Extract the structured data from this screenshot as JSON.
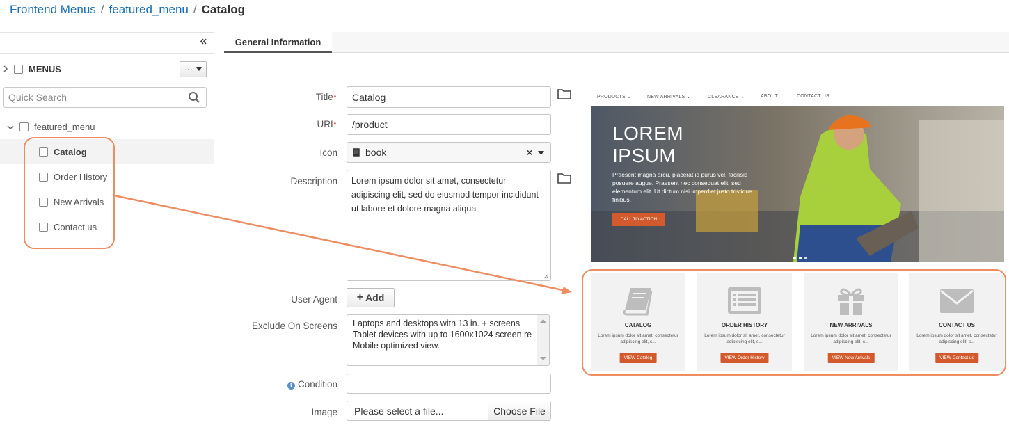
{
  "breadcrumb": {
    "items": [
      "Frontend Menus",
      "featured_menu"
    ],
    "current": "Catalog",
    "separator": "/"
  },
  "sidebar": {
    "collapse_icon": "double-chevron-left",
    "root_label": "MENUS",
    "actions_label": "···",
    "search_placeholder": "Quick Search",
    "tree": {
      "parent": "featured_menu",
      "children": [
        "Catalog",
        "Order History",
        "New Arrivals",
        "Contact us"
      ],
      "selected": "Catalog"
    }
  },
  "tabs": {
    "active": "General Information"
  },
  "form": {
    "title_label": "Title",
    "title_value": "Catalog",
    "uri_label": "URI",
    "uri_value": "/product",
    "icon_label": "Icon",
    "icon_value": "book",
    "description_label": "Description",
    "description_value": "Lorem ipsum dolor sit amet, consectetur adipiscing elit, sed do eiusmod tempor incididunt ut labore et dolore magna aliqua",
    "user_agent_label": "User Agent",
    "add_label": "Add",
    "exclude_label": "Exclude On Screens",
    "exclude_options": [
      "Laptops and desktops with 13 in. + screens",
      "Tablet devices with up to 1600x1024 screen re",
      "Mobile optimized view."
    ],
    "condition_label": "Condition",
    "image_label": "Image",
    "image_placeholder": "Please select a file...",
    "choose_file_label": "Choose File",
    "required_mark": "*"
  },
  "preview": {
    "nav": [
      "PRODUCTS",
      "NEW ARRIVALS",
      "CLEARANCE",
      "ABOUT",
      "CONTACT US"
    ],
    "hero_title_1": "LOREM",
    "hero_title_2": "IPSUM",
    "hero_text": "Praesent magna arcu, placerat id purus vel, facilisis posuere augue. Praesent nec consequat elit, sed elementum elit. Ut dictum nisi imperdiet justo tristique finibus.",
    "cta_label": "CALL TO ACTION",
    "cards": [
      {
        "title": "CATALOG",
        "text": "Lorem ipsum dolor sit amet, consectetur adipiscing elit, s...",
        "button": "VIEW Catalog",
        "icon": "book-icon"
      },
      {
        "title": "ORDER HISTORY",
        "text": "Lorem ipsum dolor sit amet, consectetur adipiscing elit, s...",
        "button": "VIEW Order History",
        "icon": "list-icon"
      },
      {
        "title": "NEW ARRIVALS",
        "text": "Lorem ipsum dolor sit amet, consectetur adipiscing elit, s...",
        "button": "VIEW New Arrivals",
        "icon": "gift-icon"
      },
      {
        "title": "CONTACT US",
        "text": "Lorem ipsum dolor sit amet, consectetur adipiscing elit, s...",
        "button": "VIEW Contact us",
        "icon": "envelope-icon"
      }
    ]
  },
  "colors": {
    "link": "#1a6fb3",
    "highlight": "#ee8c62",
    "accent_button": "#d35a2d",
    "required": "#d9534f"
  }
}
